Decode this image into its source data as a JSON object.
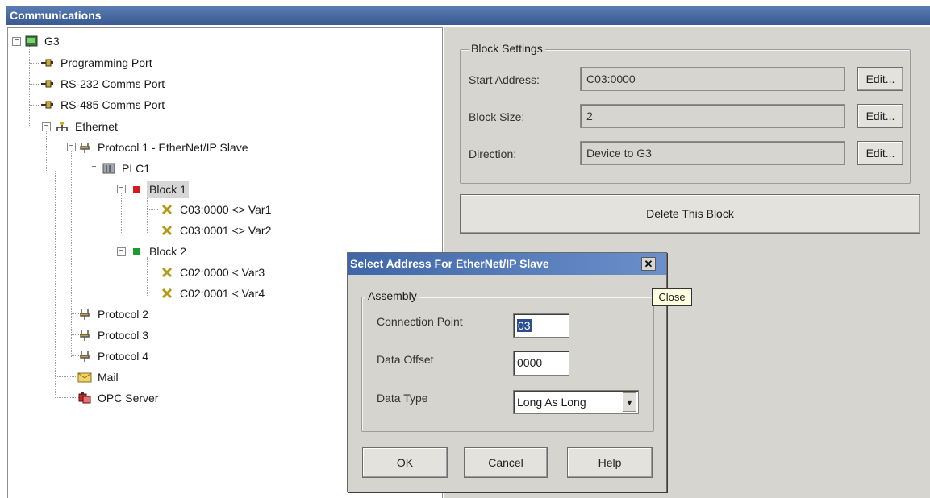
{
  "window": {
    "title": "Communications"
  },
  "tree": {
    "root": "G3",
    "programming_port": "Programming Port",
    "rs232": "RS-232 Comms Port",
    "rs485": "RS-485 Comms Port",
    "ethernet": "Ethernet",
    "protocol1": "Protocol 1 - EtherNet/IP Slave",
    "plc1": "PLC1",
    "block1": "Block 1",
    "b1_item1": "C03:0000 <> Var1",
    "b1_item2": "C03:0001 <> Var2",
    "block2": "Block 2",
    "b2_item1": "C02:0000 < Var3",
    "b2_item2": "C02:0001 < Var4",
    "protocol2": "Protocol 2",
    "protocol3": "Protocol 3",
    "protocol4": "Protocol 4",
    "mail": "Mail",
    "opc": "OPC Server"
  },
  "block_settings": {
    "legend": "Block Settings",
    "start_address_label": "Start Address:",
    "start_address_value": "C03:0000",
    "block_size_label": "Block Size:",
    "block_size_value": "2",
    "direction_label": "Direction:",
    "direction_value": "Device to G3",
    "edit_label": "Edit...",
    "delete_label": "Delete This Block"
  },
  "dialog": {
    "title": "Select Address For EtherNet/IP Slave",
    "close_symbol": "✕",
    "tooltip": "Close",
    "group_legend_first": "A",
    "group_legend_rest": "ssembly",
    "connection_point_label": "Connection Point",
    "connection_point_value": "03",
    "data_offset_label": "Data Offset",
    "data_offset_value": "0000",
    "data_type_label": "Data Type",
    "data_type_value": "Long As Long",
    "ok": "OK",
    "cancel": "Cancel",
    "help": "Help"
  },
  "colors": {
    "titlebar": "#46689f",
    "dialog_titlebar": "#3f66a8",
    "panel": "#d7d5cf",
    "block1_marker": "#d71920",
    "block2_marker": "#1e9a32"
  }
}
